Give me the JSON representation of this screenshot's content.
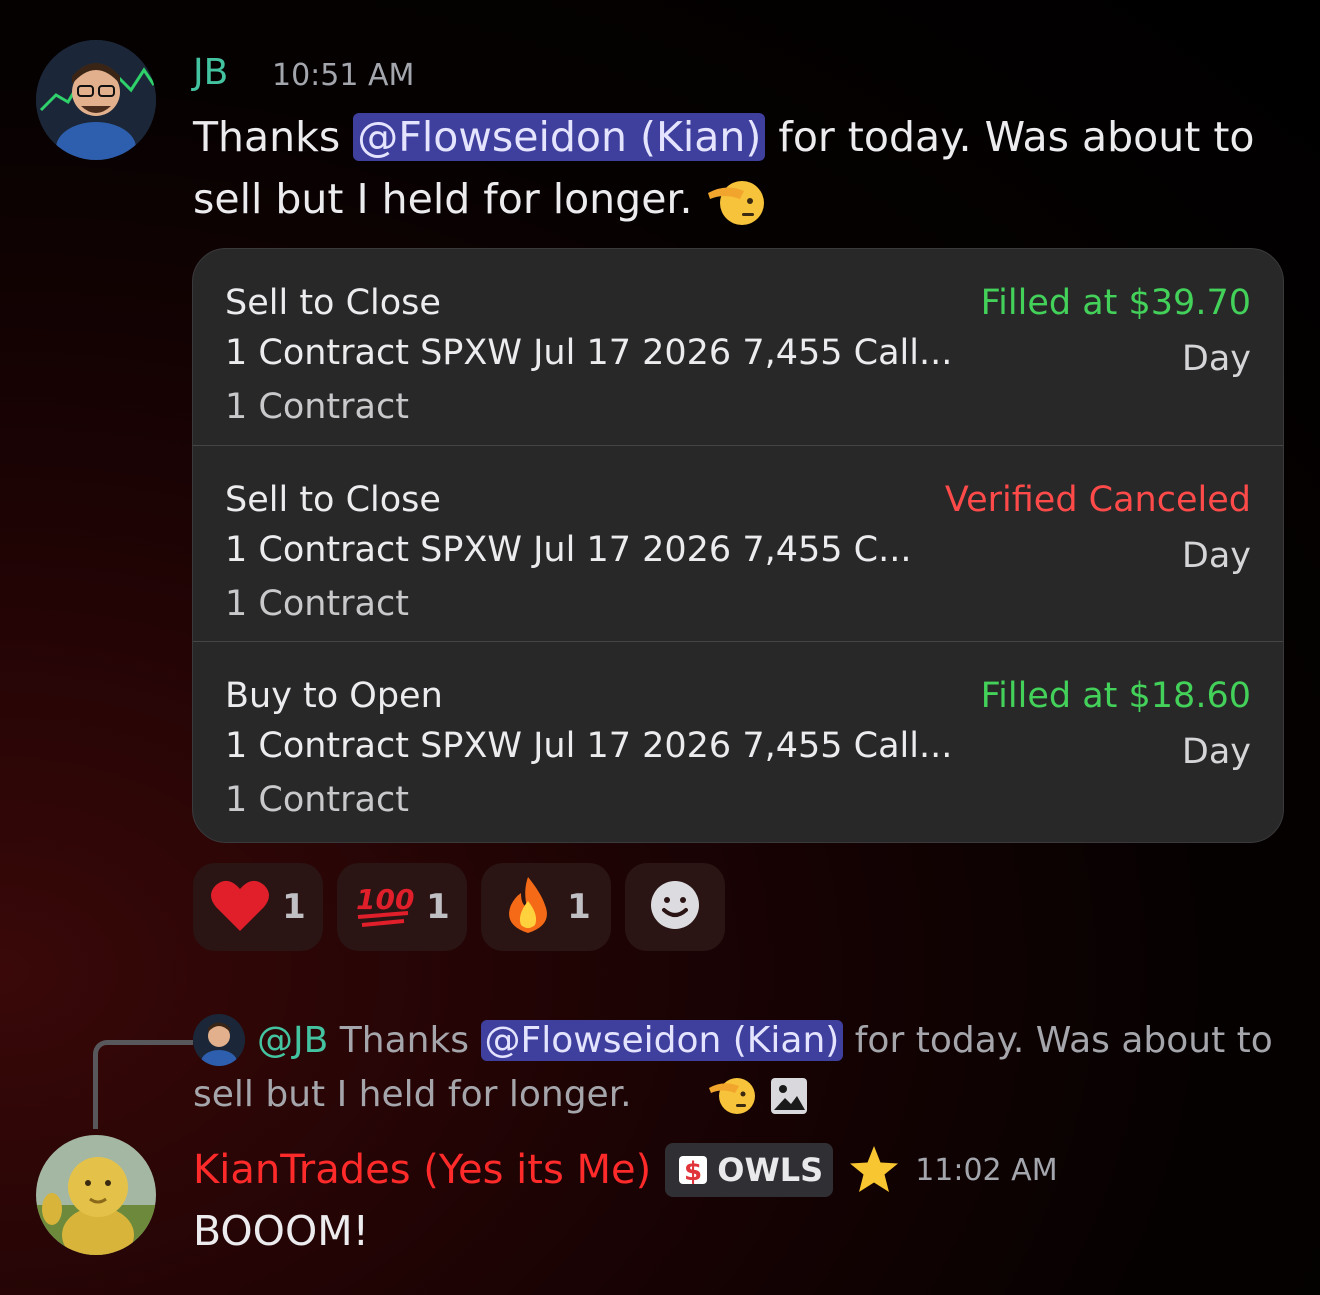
{
  "message1": {
    "author": "JB",
    "timestamp": "10:51 AM",
    "text_before": "Thanks ",
    "mention": "@Flowseidon (Kian)",
    "text_after": " for today. Was about to sell but I held for longer.",
    "emoji": "saluting-face"
  },
  "orders": [
    {
      "title": "Sell to Close",
      "description": "1 Contract SPXW Jul 17 2026 7,455 Call...",
      "quantity": "1 Contract",
      "status": "Filled at $39.70",
      "status_color": "#43d15a",
      "tif": "Day"
    },
    {
      "title": "Sell to Close",
      "description": "1 Contract SPXW Jul 17 2026 7,455 C...",
      "quantity": "1 Contract",
      "status": "Verified Canceled",
      "status_color": "#ff4a4a",
      "tif": "Day"
    },
    {
      "title": "Buy to Open",
      "description": "1 Contract SPXW Jul 17 2026 7,455 Call...",
      "quantity": "1 Contract",
      "status": "Filled at $18.60",
      "status_color": "#43d15a",
      "tif": "Day"
    }
  ],
  "reactions": [
    {
      "emoji": "heart",
      "count": "1"
    },
    {
      "emoji": "hundred-points",
      "count": "1"
    },
    {
      "emoji": "fire",
      "count": "1"
    },
    {
      "emoji": "add-reaction"
    }
  ],
  "reply": {
    "author": "@JB",
    "text_before": " Thanks ",
    "mention": "@Flowseidon (Kian)",
    "text_after": " for today. Was about to sell but I held for longer."
  },
  "message2": {
    "author": "KianTrades (Yes its Me)",
    "tag": "OWLS",
    "timestamp": "11:02 AM",
    "text": "BOOOM!"
  }
}
